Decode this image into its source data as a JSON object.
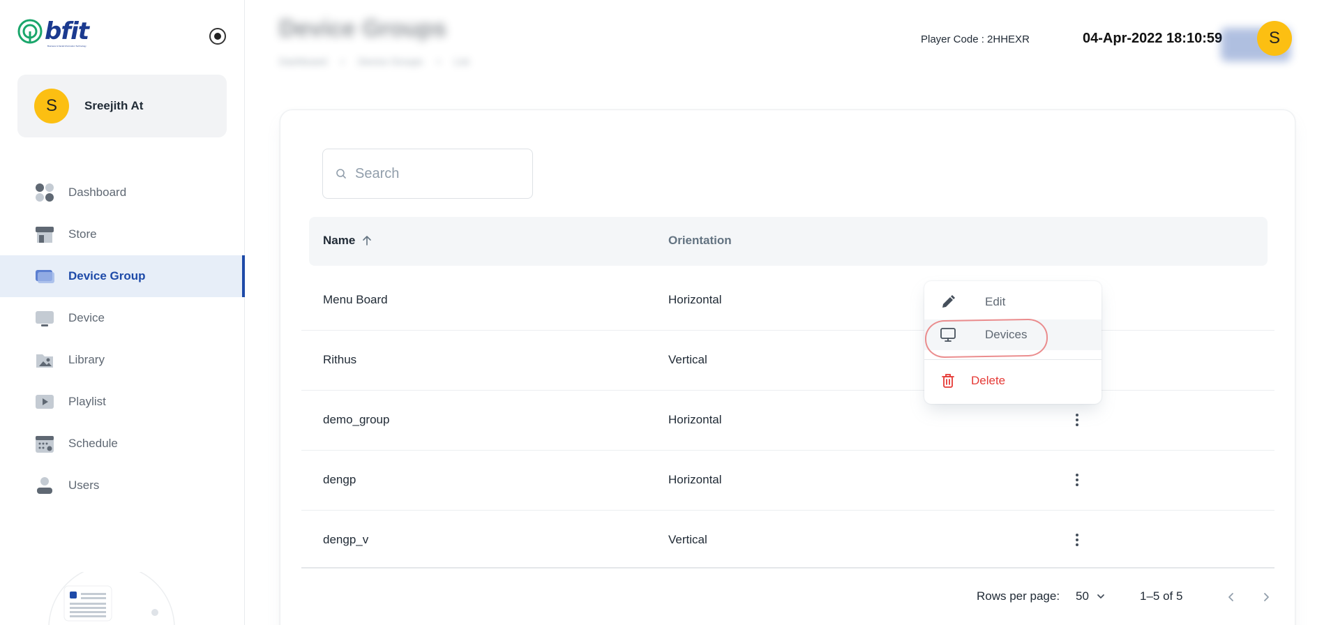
{
  "brand": {
    "logo_text": "bfit",
    "tagline": "Business & Facial Information Technology"
  },
  "sidebar": {
    "user": {
      "initial": "S",
      "name": "Sreejith At"
    },
    "items": [
      {
        "label": "Dashboard",
        "icon": "dashboard-icon",
        "active": false
      },
      {
        "label": "Store",
        "icon": "store-icon",
        "active": false
      },
      {
        "label": "Device Group",
        "icon": "device-group-icon",
        "active": true
      },
      {
        "label": "Device",
        "icon": "device-icon",
        "active": false
      },
      {
        "label": "Library",
        "icon": "library-icon",
        "active": false
      },
      {
        "label": "Playlist",
        "icon": "playlist-icon",
        "active": false
      },
      {
        "label": "Schedule",
        "icon": "schedule-icon",
        "active": false
      },
      {
        "label": "Users",
        "icon": "users-icon",
        "active": false
      }
    ]
  },
  "header": {
    "title": "Device Groups",
    "breadcrumb": [
      "Dashboard",
      "Device Groups",
      "List"
    ],
    "player_code": "Player Code : 2HHEXR",
    "datetime": "04-Apr-2022 18:10:59",
    "avatar_initial": "S"
  },
  "search": {
    "placeholder": "Search",
    "value": ""
  },
  "table": {
    "columns": {
      "name": "Name",
      "orientation": "Orientation"
    },
    "sort": "name-asc",
    "rows": [
      {
        "name": "Menu Board",
        "orientation": "Horizontal"
      },
      {
        "name": "Rithus",
        "orientation": "Vertical"
      },
      {
        "name": "demo_group",
        "orientation": "Horizontal"
      },
      {
        "name": "dengp",
        "orientation": "Horizontal"
      },
      {
        "name": "dengp_v",
        "orientation": "Vertical"
      }
    ]
  },
  "pagination": {
    "rows_per_page_label": "Rows per page:",
    "rows_per_page": "50",
    "range": "1–5 of 5"
  },
  "context_menu": {
    "edit": "Edit",
    "devices": "Devices",
    "delete": "Delete"
  },
  "colors": {
    "primary": "#1e4aa8",
    "avatar": "#fcbf12",
    "danger": "#e53935",
    "annotation": "#e8797a"
  }
}
